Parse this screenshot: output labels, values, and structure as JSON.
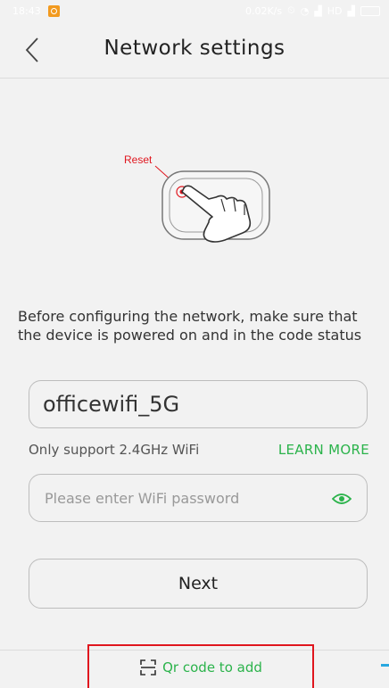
{
  "status_bar": {
    "time": "18:43",
    "net_speed": "0.02K/s",
    "network_label": "HD"
  },
  "header": {
    "back_icon": "chevron-left-icon",
    "title": "Network settings"
  },
  "illustration": {
    "reset_label": "Reset",
    "accent_color": "#e0161e"
  },
  "instructions": {
    "text": "Before configuring the network, make sure that the device is powered on and in the code status"
  },
  "wifi": {
    "ssid": "officewifi_5G",
    "support_note": "Only support 2.4GHz WiFi",
    "learn_more": "LEARN MORE",
    "password_value": "",
    "password_placeholder": "Please enter WiFi password",
    "eye_icon": "eye-icon"
  },
  "actions": {
    "next_label": "Next",
    "qr_label": "Qr code to add",
    "qr_icon": "qr-scan-icon"
  },
  "colors": {
    "accent_green": "#2bb34b",
    "highlight_red": "#e0161e"
  }
}
